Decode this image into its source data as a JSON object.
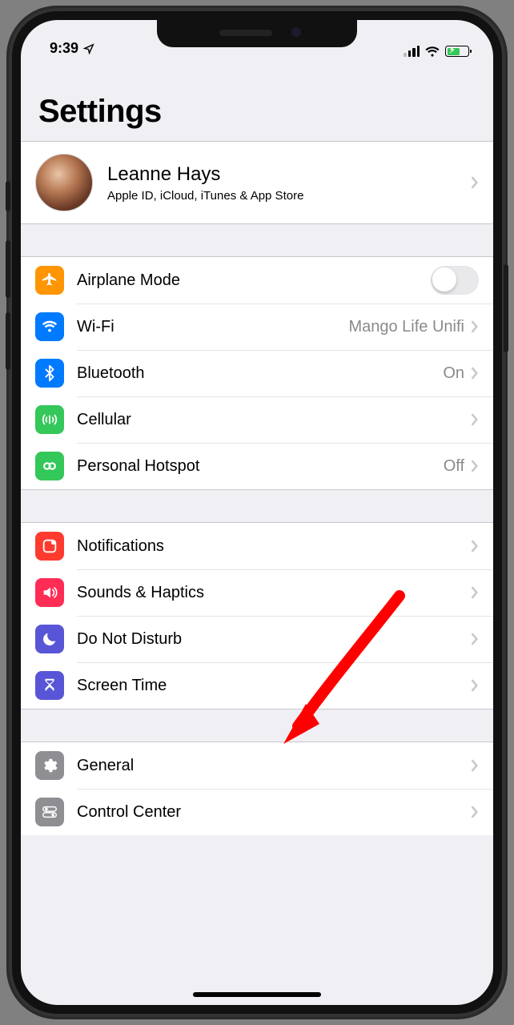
{
  "status": {
    "time": "9:39"
  },
  "header": {
    "title": "Settings"
  },
  "profile": {
    "name": "Leanne Hays",
    "subtitle": "Apple ID, iCloud, iTunes & App Store"
  },
  "groups": [
    {
      "rows": [
        {
          "icon": "airplane",
          "icon_bg": "#ff9500",
          "label": "Airplane Mode",
          "value": "",
          "control": "switch",
          "switch_on": false
        },
        {
          "icon": "wifi",
          "icon_bg": "#007aff",
          "label": "Wi-Fi",
          "value": "Mango Life Unifi",
          "control": "disclosure"
        },
        {
          "icon": "bluetooth",
          "icon_bg": "#007aff",
          "label": "Bluetooth",
          "value": "On",
          "control": "disclosure"
        },
        {
          "icon": "cellular",
          "icon_bg": "#34c759",
          "label": "Cellular",
          "value": "",
          "control": "disclosure"
        },
        {
          "icon": "hotspot",
          "icon_bg": "#34c759",
          "label": "Personal Hotspot",
          "value": "Off",
          "control": "disclosure"
        }
      ]
    },
    {
      "rows": [
        {
          "icon": "notifications",
          "icon_bg": "#ff3b30",
          "label": "Notifications",
          "value": "",
          "control": "disclosure"
        },
        {
          "icon": "sounds",
          "icon_bg": "#ff2d55",
          "label": "Sounds & Haptics",
          "value": "",
          "control": "disclosure"
        },
        {
          "icon": "dnd",
          "icon_bg": "#5856d6",
          "label": "Do Not Disturb",
          "value": "",
          "control": "disclosure"
        },
        {
          "icon": "screentime",
          "icon_bg": "#5856d6",
          "label": "Screen Time",
          "value": "",
          "control": "disclosure"
        }
      ]
    },
    {
      "rows": [
        {
          "icon": "general",
          "icon_bg": "#8e8e93",
          "label": "General",
          "value": "",
          "control": "disclosure"
        },
        {
          "icon": "controlcenter",
          "icon_bg": "#8e8e93",
          "label": "Control Center",
          "value": "",
          "control": "disclosure"
        }
      ]
    }
  ],
  "annotation": {
    "target_label": "Sounds & Haptics"
  }
}
